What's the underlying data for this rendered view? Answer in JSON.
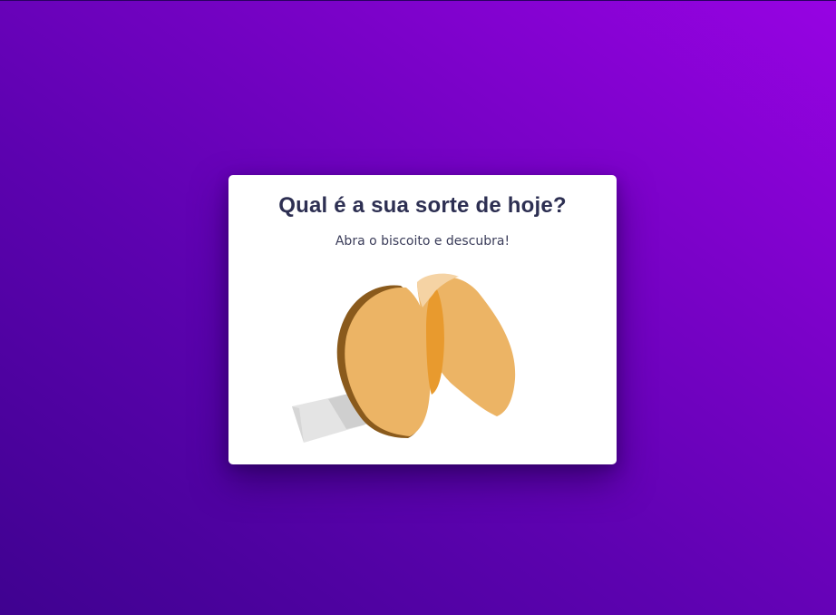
{
  "card": {
    "title": "Qual é a sua sorte de hoje?",
    "subtitle": "Abra o biscoito e descubra!"
  },
  "cookie": {
    "icon": "fortune-cookie-icon",
    "colors": {
      "dough": "#ecb465",
      "dough_dark": "#e89a2e",
      "shadow": "#8a5a1c",
      "highlight": "#f5d3a4",
      "paper": "#e4e4e4",
      "paper_shade": "#cfcfcf"
    }
  },
  "background": {
    "gradient_start": "#3f0290",
    "gradient_end": "#9703e3"
  }
}
